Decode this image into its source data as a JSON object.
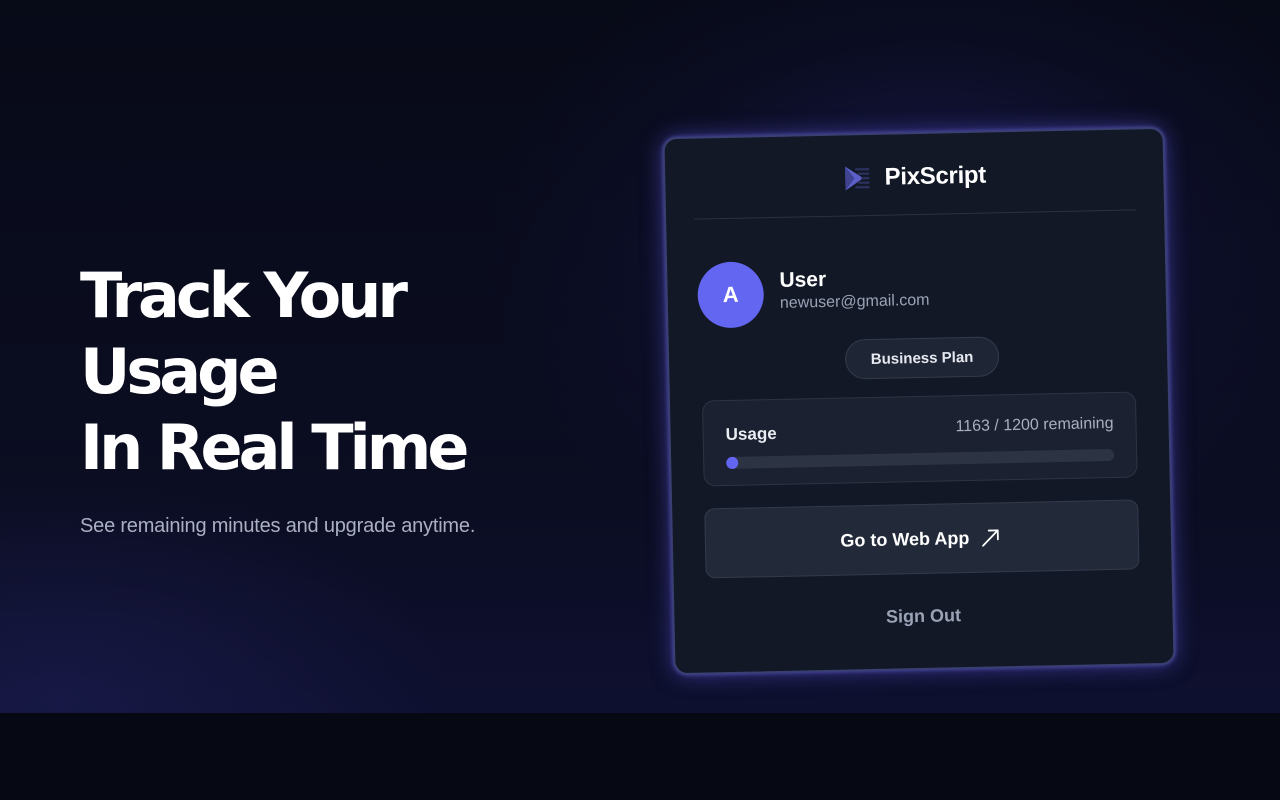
{
  "hero": {
    "headline_lines": [
      "Track Your",
      "Usage",
      "In Real Time"
    ],
    "subheadline": "See remaining minutes and upgrade anytime."
  },
  "popup": {
    "brand_name": "PixScript",
    "brand_icon": "pixscript-logo-icon",
    "user": {
      "avatar_initial": "A",
      "name": "User",
      "email": "newuser@gmail.com"
    },
    "plan_label": "Business Plan",
    "usage": {
      "label": "Usage",
      "count_text": "1163 / 1200 remaining",
      "used_fraction": 0.03
    },
    "web_app_button": {
      "label": "Go to Web App",
      "icon": "external-arrow-icon"
    },
    "sign_out_label": "Sign Out"
  },
  "colors": {
    "accent": "#6366f1",
    "background": "#070a17",
    "card": "#121826",
    "card_border_glow": "#5f5adc"
  }
}
